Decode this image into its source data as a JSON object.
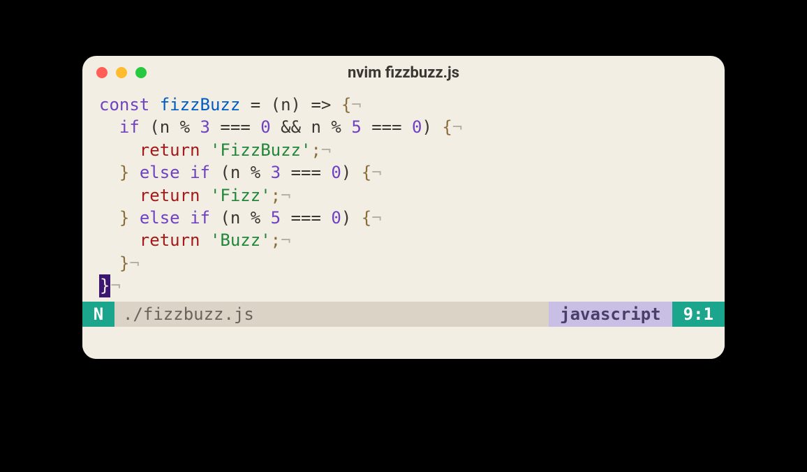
{
  "window": {
    "title": "nvim fizzbuzz.js"
  },
  "code": {
    "lines": [
      [
        {
          "cls": "tok-keyword",
          "t": "const"
        },
        {
          "cls": "tok-text",
          "t": " "
        },
        {
          "cls": "tok-func",
          "t": "fizzBuzz"
        },
        {
          "cls": "tok-text",
          "t": " "
        },
        {
          "cls": "tok-op",
          "t": "="
        },
        {
          "cls": "tok-text",
          "t": " (n) "
        },
        {
          "cls": "tok-op",
          "t": "=>"
        },
        {
          "cls": "tok-text",
          "t": " "
        },
        {
          "cls": "tok-punct",
          "t": "{"
        },
        {
          "cls": "eol",
          "t": "¬"
        }
      ],
      [
        {
          "cls": "tok-text",
          "t": "  "
        },
        {
          "cls": "tok-keyword",
          "t": "if"
        },
        {
          "cls": "tok-text",
          "t": " (n "
        },
        {
          "cls": "tok-op",
          "t": "%"
        },
        {
          "cls": "tok-text",
          "t": " "
        },
        {
          "cls": "tok-num",
          "t": "3"
        },
        {
          "cls": "tok-text",
          "t": " "
        },
        {
          "cls": "tok-op",
          "t": "==="
        },
        {
          "cls": "tok-text",
          "t": " "
        },
        {
          "cls": "tok-num",
          "t": "0"
        },
        {
          "cls": "tok-text",
          "t": " "
        },
        {
          "cls": "tok-op",
          "t": "&&"
        },
        {
          "cls": "tok-text",
          "t": " n "
        },
        {
          "cls": "tok-op",
          "t": "%"
        },
        {
          "cls": "tok-text",
          "t": " "
        },
        {
          "cls": "tok-num",
          "t": "5"
        },
        {
          "cls": "tok-text",
          "t": " "
        },
        {
          "cls": "tok-op",
          "t": "==="
        },
        {
          "cls": "tok-text",
          "t": " "
        },
        {
          "cls": "tok-num",
          "t": "0"
        },
        {
          "cls": "tok-text",
          "t": ") "
        },
        {
          "cls": "tok-punct",
          "t": "{"
        },
        {
          "cls": "eol",
          "t": "¬"
        }
      ],
      [
        {
          "cls": "tok-text",
          "t": "    "
        },
        {
          "cls": "tok-return",
          "t": "return"
        },
        {
          "cls": "tok-text",
          "t": " "
        },
        {
          "cls": "tok-string",
          "t": "'FizzBuzz'"
        },
        {
          "cls": "tok-punct",
          "t": ";"
        },
        {
          "cls": "eol",
          "t": "¬"
        }
      ],
      [
        {
          "cls": "tok-text",
          "t": "  "
        },
        {
          "cls": "tok-punct",
          "t": "}"
        },
        {
          "cls": "tok-text",
          "t": " "
        },
        {
          "cls": "tok-keyword",
          "t": "else"
        },
        {
          "cls": "tok-text",
          "t": " "
        },
        {
          "cls": "tok-keyword",
          "t": "if"
        },
        {
          "cls": "tok-text",
          "t": " (n "
        },
        {
          "cls": "tok-op",
          "t": "%"
        },
        {
          "cls": "tok-text",
          "t": " "
        },
        {
          "cls": "tok-num",
          "t": "3"
        },
        {
          "cls": "tok-text",
          "t": " "
        },
        {
          "cls": "tok-op",
          "t": "==="
        },
        {
          "cls": "tok-text",
          "t": " "
        },
        {
          "cls": "tok-num",
          "t": "0"
        },
        {
          "cls": "tok-text",
          "t": ") "
        },
        {
          "cls": "tok-punct",
          "t": "{"
        },
        {
          "cls": "eol",
          "t": "¬"
        }
      ],
      [
        {
          "cls": "tok-text",
          "t": "    "
        },
        {
          "cls": "tok-return",
          "t": "return"
        },
        {
          "cls": "tok-text",
          "t": " "
        },
        {
          "cls": "tok-string",
          "t": "'Fizz'"
        },
        {
          "cls": "tok-punct",
          "t": ";"
        },
        {
          "cls": "eol",
          "t": "¬"
        }
      ],
      [
        {
          "cls": "tok-text",
          "t": "  "
        },
        {
          "cls": "tok-punct",
          "t": "}"
        },
        {
          "cls": "tok-text",
          "t": " "
        },
        {
          "cls": "tok-keyword",
          "t": "else"
        },
        {
          "cls": "tok-text",
          "t": " "
        },
        {
          "cls": "tok-keyword",
          "t": "if"
        },
        {
          "cls": "tok-text",
          "t": " (n "
        },
        {
          "cls": "tok-op",
          "t": "%"
        },
        {
          "cls": "tok-text",
          "t": " "
        },
        {
          "cls": "tok-num",
          "t": "5"
        },
        {
          "cls": "tok-text",
          "t": " "
        },
        {
          "cls": "tok-op",
          "t": "==="
        },
        {
          "cls": "tok-text",
          "t": " "
        },
        {
          "cls": "tok-num",
          "t": "0"
        },
        {
          "cls": "tok-text",
          "t": ") "
        },
        {
          "cls": "tok-punct",
          "t": "{"
        },
        {
          "cls": "eol",
          "t": "¬"
        }
      ],
      [
        {
          "cls": "tok-text",
          "t": "    "
        },
        {
          "cls": "tok-return",
          "t": "return"
        },
        {
          "cls": "tok-text",
          "t": " "
        },
        {
          "cls": "tok-string",
          "t": "'Buzz'"
        },
        {
          "cls": "tok-punct",
          "t": ";"
        },
        {
          "cls": "eol",
          "t": "¬"
        }
      ],
      [
        {
          "cls": "tok-text",
          "t": "  "
        },
        {
          "cls": "tok-punct",
          "t": "}"
        },
        {
          "cls": "eol",
          "t": "¬"
        }
      ],
      [
        {
          "cls": "cursor-cell",
          "t": "}"
        },
        {
          "cls": "eol",
          "t": "¬"
        }
      ]
    ]
  },
  "statusbar": {
    "mode": "N",
    "file": "./fizzbuzz.js",
    "language": "javascript",
    "position": "9:1"
  }
}
